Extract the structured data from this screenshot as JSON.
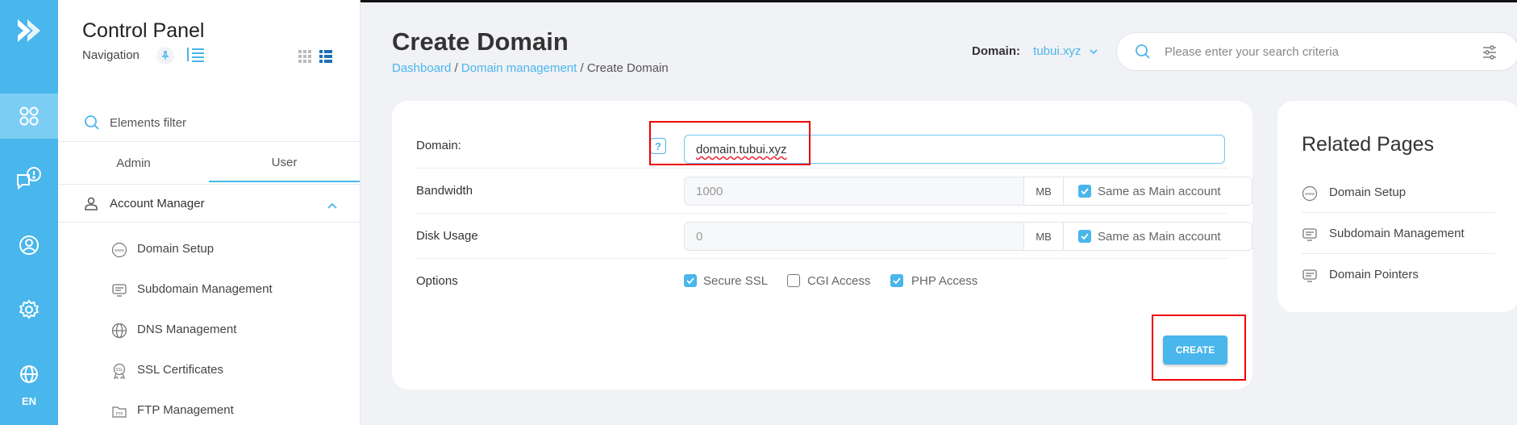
{
  "rail": {
    "language": "EN"
  },
  "nav": {
    "title": "Control Panel",
    "subtitle": "Navigation",
    "filter_placeholder": "Elements filter",
    "tabs": [
      {
        "label": "Admin"
      },
      {
        "label": "User"
      }
    ],
    "section": "Account Manager",
    "items": [
      {
        "label": "Domain Setup",
        "icon": "www-icon"
      },
      {
        "label": "Subdomain Management",
        "icon": "monitor-icon"
      },
      {
        "label": "DNS Management",
        "icon": "globe-icon"
      },
      {
        "label": "SSL Certificates",
        "icon": "ssl-icon"
      },
      {
        "label": "FTP Management",
        "icon": "ftp-folder-icon"
      }
    ]
  },
  "header": {
    "title": "Create Domain",
    "breadcrumb": {
      "home": "Dashboard",
      "parent": "Domain management",
      "sep": "/",
      "current": "Create Domain"
    },
    "domain_label": "Domain:",
    "domain_value": "tubui.xyz",
    "search_placeholder": "Please enter your search criteria"
  },
  "form": {
    "domain_label": "Domain:",
    "help": "?",
    "domain_value": "domain.tubui.xyz",
    "bandwidth_label": "Bandwidth",
    "bandwidth_value": "1000",
    "disk_label": "Disk Usage",
    "disk_value": "0",
    "unit": "MB",
    "same_label": "Same as Main account",
    "options_label": "Options",
    "options": [
      {
        "label": "Secure SSL",
        "checked": true
      },
      {
        "label": "CGI Access",
        "checked": false
      },
      {
        "label": "PHP Access",
        "checked": true
      }
    ],
    "create_label": "CREATE"
  },
  "related": {
    "title": "Related Pages",
    "items": [
      {
        "label": "Domain Setup",
        "icon": "www-icon"
      },
      {
        "label": "Subdomain Management",
        "icon": "monitor-icon"
      },
      {
        "label": "Domain Pointers",
        "icon": "monitor-icon"
      }
    ]
  },
  "colors": {
    "accent": "#49b6ec",
    "rail": "#49b6ec",
    "highlight": "#ee0000"
  }
}
